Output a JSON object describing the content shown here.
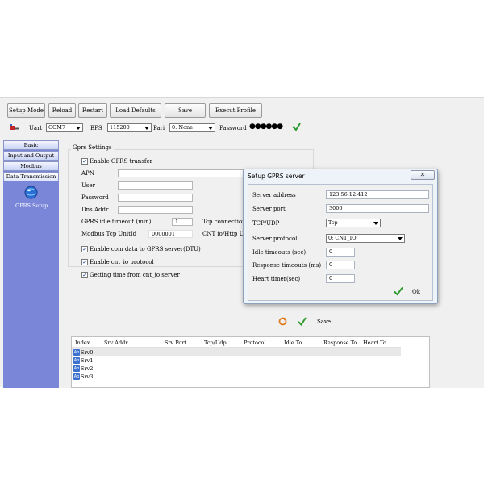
{
  "toolbar": {
    "buttons": [
      "Setup Mode",
      "Reload",
      "Restart",
      "Load Defaults",
      "Save",
      "Execut Profile"
    ]
  },
  "connection": {
    "uart_label": "Uart",
    "uart_value": "COM7",
    "bps_label": "BPS",
    "bps_value": "115200",
    "pari_label": "Pari",
    "pari_value": "0: None",
    "password_label": "Password",
    "password_value": "●●●●●●"
  },
  "nav": {
    "items": [
      "Basic",
      "Input and Output",
      "Modbus",
      "Data Transmission"
    ],
    "active": "Data Transmission",
    "gprs_label": "GPRS Setup"
  },
  "gprs": {
    "section_title": "Gprs Settings",
    "enable_transfer": "Enable GPRS transfer",
    "apn_label": "APN",
    "user_label": "User",
    "password_label": "Password",
    "dns_label": "Dns Addr",
    "idle_label": "GPRS idle timeout (min)",
    "idle_value": "1",
    "tcp_conn_label": "Tcp connection",
    "modbus_unit_label": "Modbus Tcp UnitId",
    "modbus_unit_value": "0000001",
    "cnt_label": "CNT io/Http Ur",
    "enable_com": "Enable com data to GPRS server(DTU)",
    "enable_cnt": "Enable cnt_io protocol",
    "getting_time": "Getting time from cnt_io server",
    "save_label": "Save"
  },
  "table": {
    "headers": [
      "Index",
      "Srv Addr",
      "Srv Port",
      "Tcp/Udp",
      "Protocol",
      "Idle To",
      "Response To",
      "Heart To"
    ],
    "rows": [
      "Srv0",
      "Srv1",
      "Srv2",
      "Srv3"
    ]
  },
  "dialog": {
    "title": "Setup GPRS server",
    "server_address_label": "Server address",
    "server_address_value": "123.56.12.412",
    "server_port_label": "Server port",
    "server_port_value": "3000",
    "tcpudp_label": "TCP/UDP",
    "tcpudp_value": "Tcp",
    "protocol_label": "Server protocol",
    "protocol_value": "0: CNT_IO",
    "idle_label": "Idle timeouts (sec)",
    "idle_value": "0",
    "response_label": "Response timeouts (ms)",
    "response_value": "0",
    "heart_label": "Heart timer(sec)",
    "heart_value": "0",
    "ok_label": "Ok"
  }
}
